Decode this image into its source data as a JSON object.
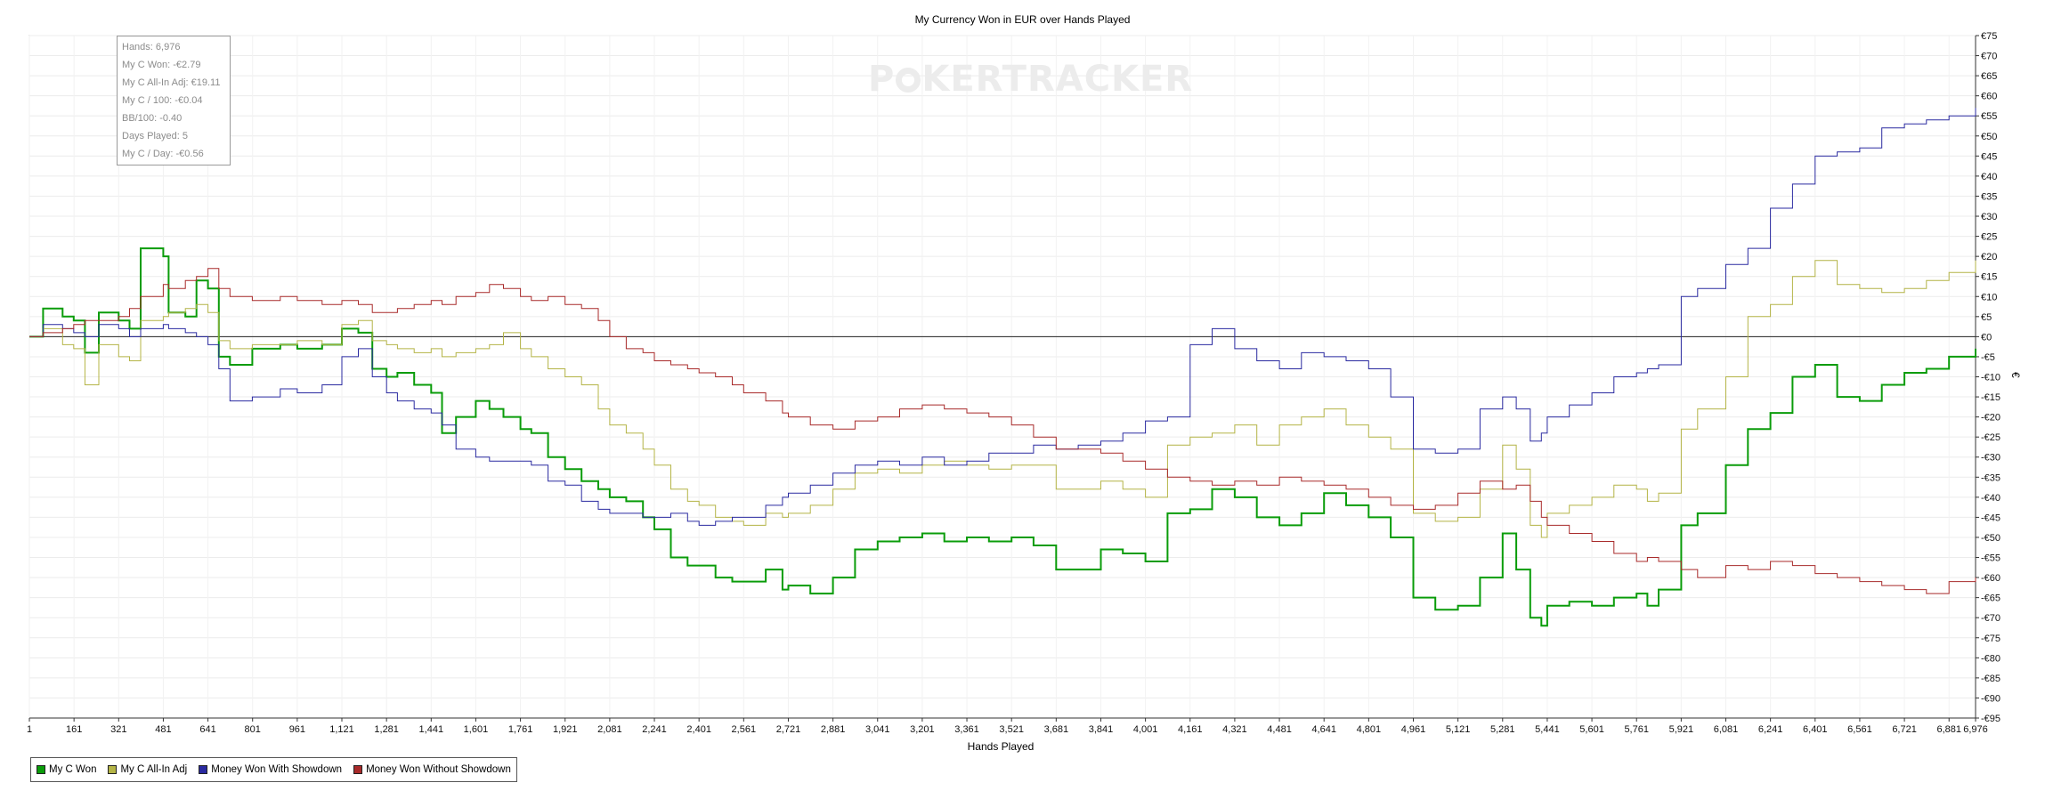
{
  "stats": [
    "Hands: 6,976",
    "My C Won: -€2.79",
    "My C All-In Adj: €19.11",
    "My C / 100: -€0.04",
    "BB/100: -0.40",
    "Days Played: 5",
    "My C / Day: -€0.56"
  ],
  "watermark": {
    "left": "P",
    "right": "KERTRACKER"
  },
  "chart_data": {
    "type": "line",
    "title": "My Currency Won in EUR over Hands Played",
    "xlabel": "Hands Played",
    "ylabel": "€",
    "xlim": [
      1,
      6976
    ],
    "ylim": [
      -95,
      75
    ],
    "x_ticks": [
      1,
      161,
      321,
      481,
      641,
      801,
      961,
      1121,
      1281,
      1441,
      1601,
      1761,
      1921,
      2081,
      2241,
      2401,
      2561,
      2721,
      2881,
      3041,
      3201,
      3361,
      3521,
      3681,
      3841,
      4001,
      4161,
      4321,
      4481,
      4641,
      4801,
      4961,
      5121,
      5281,
      5441,
      5601,
      5761,
      5921,
      6081,
      6241,
      6401,
      6561,
      6721,
      6881,
      6976
    ],
    "x_tick_labels": [
      "1",
      "161",
      "321",
      "481",
      "641",
      "801",
      "961",
      "1,121",
      "1,281",
      "1,441",
      "1,601",
      "1,761",
      "1,921",
      "2,081",
      "2,241",
      "2,401",
      "2,561",
      "2,721",
      "2,881",
      "3,041",
      "3,201",
      "3,361",
      "3,521",
      "3,681",
      "3,841",
      "4,001",
      "4,161",
      "4,321",
      "4,481",
      "4,641",
      "4,801",
      "4,961",
      "5,121",
      "5,281",
      "5,441",
      "5,601",
      "5,761",
      "5,921",
      "6,081",
      "6,241",
      "6,401",
      "6,561",
      "6,721",
      "6,881",
      "6,976"
    ],
    "y_ticks": [
      75,
      70,
      65,
      60,
      55,
      50,
      45,
      40,
      35,
      30,
      25,
      20,
      15,
      10,
      5,
      0,
      -5,
      -10,
      -15,
      -20,
      -25,
      -30,
      -35,
      -40,
      -45,
      -50,
      -55,
      -60,
      -65,
      -70,
      -75,
      -80,
      -85,
      -90,
      -95
    ],
    "y_tick_labels": [
      "€75",
      "€70",
      "€65",
      "€60",
      "€55",
      "€50",
      "€45",
      "€40",
      "€35",
      "€30",
      "€25",
      "€20",
      "€15",
      "€10",
      "€5",
      "€0",
      "-€5",
      "-€10",
      "-€15",
      "-€20",
      "-€25",
      "-€30",
      "-€35",
      "-€40",
      "-€45",
      "-€50",
      "-€55",
      "-€60",
      "-€65",
      "-€70",
      "-€75",
      "-€80",
      "-€85",
      "-€90",
      "-€95"
    ],
    "grid": true,
    "zero_line": true,
    "legend_position": "bottom-left",
    "series": [
      {
        "name": "My C Won",
        "color": "#0a9c0a",
        "stroke_width": 2,
        "x": [
          1,
          50,
          120,
          160,
          200,
          250,
          321,
          360,
          400,
          481,
          500,
          560,
          600,
          641,
          680,
          720,
          800,
          900,
          961,
          1050,
          1121,
          1180,
          1230,
          1281,
          1320,
          1380,
          1441,
          1480,
          1530,
          1601,
          1650,
          1700,
          1761,
          1800,
          1860,
          1921,
          1980,
          2040,
          2081,
          2140,
          2200,
          2241,
          2300,
          2360,
          2401,
          2460,
          2520,
          2561,
          2640,
          2700,
          2721,
          2800,
          2881,
          2960,
          3041,
          3120,
          3201,
          3280,
          3361,
          3440,
          3521,
          3600,
          3681,
          3760,
          3841,
          3920,
          4001,
          4080,
          4161,
          4240,
          4321,
          4400,
          4481,
          4560,
          4641,
          4720,
          4801,
          4880,
          4961,
          5040,
          5121,
          5200,
          5281,
          5330,
          5380,
          5420,
          5441,
          5520,
          5601,
          5680,
          5761,
          5800,
          5840,
          5921,
          5980,
          6081,
          6160,
          6241,
          6320,
          6401,
          6480,
          6561,
          6640,
          6721,
          6800,
          6881,
          6976
        ],
        "y": [
          0,
          7,
          5,
          4,
          -4,
          6,
          4,
          2,
          22,
          20,
          6,
          5,
          14,
          12,
          -5,
          -7,
          -3,
          -2,
          -3,
          -2,
          2,
          1,
          -8,
          -10,
          -9,
          -12,
          -14,
          -24,
          -20,
          -16,
          -18,
          -20,
          -23,
          -24,
          -30,
          -33,
          -36,
          -38,
          -40,
          -41,
          -45,
          -48,
          -55,
          -57,
          -57,
          -60,
          -61,
          -61,
          -58,
          -63,
          -62,
          -64,
          -60,
          -53,
          -51,
          -50,
          -49,
          -51,
          -50,
          -51,
          -50,
          -52,
          -58,
          -58,
          -53,
          -54,
          -56,
          -44,
          -43,
          -38,
          -40,
          -45,
          -47,
          -44,
          -39,
          -42,
          -45,
          -50,
          -65,
          -68,
          -67,
          -60,
          -49,
          -58,
          -70,
          -72,
          -67,
          -66,
          -67,
          -65,
          -64,
          -67,
          -63,
          -47,
          -44,
          -32,
          -23,
          -19,
          -10,
          -7,
          -15,
          -16,
          -12,
          -9,
          -8,
          -5,
          -3
        ]
      },
      {
        "name": "My C All-In Adj",
        "color": "#b4b446",
        "stroke_width": 1,
        "x": [
          1,
          50,
          120,
          160,
          200,
          250,
          321,
          360,
          400,
          481,
          500,
          560,
          600,
          641,
          680,
          720,
          800,
          900,
          961,
          1050,
          1121,
          1180,
          1230,
          1281,
          1320,
          1380,
          1441,
          1480,
          1530,
          1601,
          1650,
          1700,
          1761,
          1800,
          1860,
          1921,
          1980,
          2040,
          2081,
          2140,
          2200,
          2241,
          2300,
          2360,
          2401,
          2460,
          2520,
          2561,
          2640,
          2700,
          2721,
          2800,
          2881,
          2960,
          3041,
          3120,
          3201,
          3280,
          3361,
          3440,
          3521,
          3600,
          3681,
          3760,
          3841,
          3920,
          4001,
          4080,
          4161,
          4240,
          4321,
          4400,
          4481,
          4560,
          4641,
          4720,
          4801,
          4880,
          4961,
          5040,
          5121,
          5200,
          5281,
          5330,
          5380,
          5420,
          5441,
          5520,
          5601,
          5680,
          5761,
          5800,
          5840,
          5921,
          5980,
          6081,
          6160,
          6241,
          6320,
          6401,
          6480,
          6561,
          6640,
          6721,
          6800,
          6881,
          6976
        ],
        "y": [
          0,
          2,
          -2,
          -3,
          -12,
          -2,
          -5,
          -6,
          4,
          5,
          6,
          7,
          8,
          6,
          -1,
          -3,
          -2,
          -2,
          -1,
          -2,
          3,
          4,
          -1,
          -2,
          -3,
          -4,
          -3,
          -5,
          -4,
          -3,
          -2,
          1,
          -3,
          -5,
          -8,
          -10,
          -12,
          -18,
          -22,
          -24,
          -28,
          -32,
          -38,
          -41,
          -42,
          -45,
          -46,
          -47,
          -44,
          -45,
          -44,
          -42,
          -38,
          -34,
          -33,
          -34,
          -32,
          -31,
          -32,
          -33,
          -32,
          -32,
          -38,
          -38,
          -36,
          -38,
          -40,
          -27,
          -25,
          -24,
          -22,
          -27,
          -22,
          -20,
          -18,
          -22,
          -25,
          -28,
          -44,
          -46,
          -45,
          -38,
          -27,
          -33,
          -47,
          -50,
          -44,
          -42,
          -40,
          -37,
          -38,
          -41,
          -39,
          -23,
          -18,
          -10,
          5,
          8,
          15,
          19,
          13,
          12,
          11,
          12,
          14,
          16,
          19
        ]
      },
      {
        "name": "Money Won With Showdown",
        "color": "#2a2aa0",
        "stroke_width": 1,
        "x": [
          1,
          50,
          120,
          160,
          200,
          250,
          321,
          360,
          400,
          481,
          500,
          560,
          600,
          641,
          680,
          720,
          800,
          900,
          961,
          1050,
          1121,
          1180,
          1230,
          1281,
          1320,
          1380,
          1441,
          1480,
          1530,
          1601,
          1650,
          1700,
          1761,
          1800,
          1860,
          1921,
          1980,
          2040,
          2081,
          2140,
          2200,
          2241,
          2300,
          2360,
          2401,
          2460,
          2520,
          2561,
          2640,
          2700,
          2721,
          2800,
          2881,
          2960,
          3041,
          3120,
          3201,
          3280,
          3361,
          3440,
          3521,
          3600,
          3681,
          3760,
          3841,
          3920,
          4001,
          4080,
          4161,
          4240,
          4321,
          4400,
          4481,
          4560,
          4641,
          4720,
          4801,
          4880,
          4961,
          5040,
          5121,
          5200,
          5281,
          5330,
          5380,
          5420,
          5441,
          5520,
          5601,
          5680,
          5761,
          5800,
          5840,
          5921,
          5980,
          6081,
          6160,
          6241,
          6320,
          6401,
          6480,
          6561,
          6640,
          6721,
          6800,
          6881,
          6976
        ],
        "y": [
          0,
          3,
          2,
          1,
          0,
          3,
          2,
          0,
          2,
          3,
          2,
          1,
          0,
          -2,
          -8,
          -16,
          -15,
          -13,
          -14,
          -12,
          -5,
          -3,
          -10,
          -14,
          -16,
          -18,
          -19,
          -22,
          -28,
          -30,
          -31,
          -31,
          -31,
          -32,
          -36,
          -37,
          -41,
          -43,
          -44,
          -44,
          -45,
          -45,
          -44,
          -46,
          -47,
          -46,
          -45,
          -45,
          -42,
          -40,
          -39,
          -37,
          -34,
          -32,
          -31,
          -32,
          -30,
          -32,
          -31,
          -29,
          -29,
          -27,
          -28,
          -27,
          -26,
          -24,
          -21,
          -20,
          -2,
          2,
          -3,
          -6,
          -8,
          -4,
          -5,
          -6,
          -8,
          -15,
          -28,
          -29,
          -28,
          -18,
          -15,
          -18,
          -26,
          -24,
          -20,
          -17,
          -14,
          -10,
          -9,
          -8,
          -7,
          10,
          12,
          18,
          22,
          32,
          38,
          45,
          46,
          47,
          52,
          53,
          54,
          55,
          57
        ]
      },
      {
        "name": "Money Won Without Showdown",
        "color": "#a82a2a",
        "stroke_width": 1,
        "x": [
          1,
          50,
          120,
          160,
          200,
          250,
          321,
          360,
          400,
          481,
          500,
          560,
          600,
          641,
          680,
          720,
          800,
          900,
          961,
          1050,
          1121,
          1180,
          1230,
          1281,
          1320,
          1380,
          1441,
          1480,
          1530,
          1601,
          1650,
          1700,
          1761,
          1800,
          1860,
          1921,
          1980,
          2040,
          2081,
          2140,
          2200,
          2241,
          2300,
          2360,
          2401,
          2460,
          2520,
          2561,
          2640,
          2700,
          2721,
          2800,
          2881,
          2960,
          3041,
          3120,
          3201,
          3280,
          3361,
          3440,
          3521,
          3600,
          3681,
          3760,
          3841,
          3920,
          4001,
          4080,
          4161,
          4240,
          4321,
          4400,
          4481,
          4560,
          4641,
          4720,
          4801,
          4880,
          4961,
          5040,
          5121,
          5200,
          5281,
          5330,
          5380,
          5420,
          5441,
          5520,
          5601,
          5680,
          5761,
          5800,
          5840,
          5921,
          5980,
          6081,
          6160,
          6241,
          6320,
          6401,
          6480,
          6561,
          6640,
          6721,
          6800,
          6881,
          6976
        ],
        "y": [
          0,
          1,
          2,
          3,
          4,
          4,
          5,
          7,
          10,
          13,
          12,
          14,
          15,
          17,
          12,
          10,
          9,
          10,
          9,
          8,
          9,
          8,
          6,
          6,
          7,
          8,
          9,
          8,
          10,
          11,
          13,
          12,
          10,
          9,
          10,
          8,
          7,
          4,
          0,
          -3,
          -4,
          -6,
          -7,
          -8,
          -9,
          -10,
          -12,
          -14,
          -16,
          -19,
          -20,
          -22,
          -23,
          -21,
          -20,
          -18,
          -17,
          -18,
          -19,
          -20,
          -22,
          -25,
          -28,
          -28,
          -29,
          -31,
          -33,
          -35,
          -36,
          -37,
          -36,
          -37,
          -35,
          -36,
          -37,
          -38,
          -40,
          -42,
          -43,
          -42,
          -39,
          -36,
          -38,
          -37,
          -41,
          -45,
          -47,
          -49,
          -51,
          -54,
          -56,
          -55,
          -56,
          -58,
          -60,
          -57,
          -58,
          -56,
          -57,
          -59,
          -60,
          -61,
          -62,
          -63,
          -64,
          -61,
          -60
        ]
      }
    ]
  }
}
